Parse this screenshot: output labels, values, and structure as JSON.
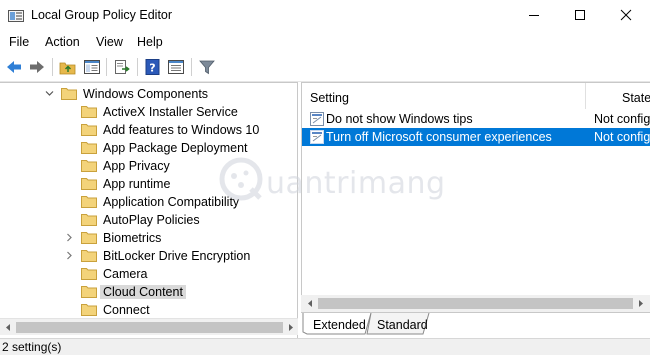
{
  "window": {
    "title": "Local Group Policy Editor",
    "accent_color": "#0078d7"
  },
  "menu": {
    "items": [
      {
        "label": "File"
      },
      {
        "label": "Action"
      },
      {
        "label": "View"
      },
      {
        "label": "Help"
      }
    ]
  },
  "toolbar": {
    "buttons": [
      {
        "icon": "back-arrow-icon"
      },
      {
        "icon": "forward-arrow-icon"
      },
      {
        "icon": "up-folder-icon"
      },
      {
        "icon": "show-hide-tree-icon"
      },
      {
        "icon": "export-list-icon"
      },
      {
        "icon": "help-icon"
      },
      {
        "icon": "properties-icon"
      },
      {
        "icon": "filter-icon"
      }
    ]
  },
  "tree": {
    "items": [
      {
        "label": "Windows Components",
        "expanded": true
      },
      {
        "label": "ActiveX Installer Service"
      },
      {
        "label": "Add features to Windows 10"
      },
      {
        "label": "App Package Deployment"
      },
      {
        "label": "App Privacy"
      },
      {
        "label": "App runtime"
      },
      {
        "label": "Application Compatibility"
      },
      {
        "label": "AutoPlay Policies"
      },
      {
        "label": "Biometrics",
        "expandable": true
      },
      {
        "label": "BitLocker Drive Encryption",
        "expandable": true
      },
      {
        "label": "Camera"
      },
      {
        "label": "Cloud Content",
        "selected": true
      },
      {
        "label": "Connect"
      }
    ]
  },
  "settings": {
    "columns": [
      {
        "label": "Setting"
      },
      {
        "label": "State"
      }
    ],
    "rows": [
      {
        "name": "Do not show Windows tips",
        "state": "Not configured"
      },
      {
        "name": "Turn off Microsoft consumer experiences",
        "state": "Not configured",
        "selected": true
      }
    ]
  },
  "tabs": [
    {
      "label": "Extended"
    },
    {
      "label": "Standard"
    }
  ],
  "status": {
    "text": "2 setting(s)"
  },
  "watermark": {
    "text": "uantrimang"
  }
}
